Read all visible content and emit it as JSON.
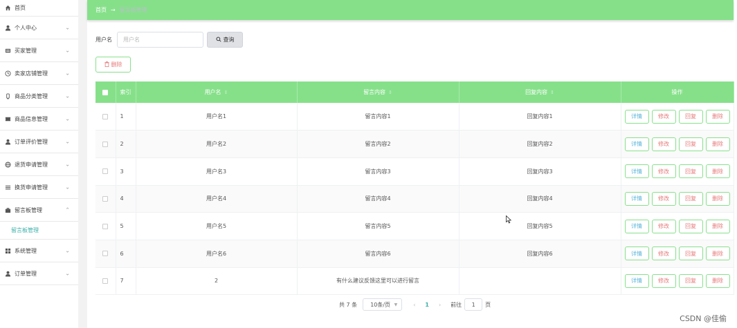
{
  "sidebar": {
    "items": [
      {
        "label": "首页",
        "icon": "home-icon",
        "chevron": false
      },
      {
        "label": "个人中心",
        "icon": "user-icon",
        "chevron": true
      },
      {
        "label": "买家管理",
        "icon": "list-icon",
        "chevron": true
      },
      {
        "label": "卖家店铺管理",
        "icon": "clock-icon",
        "chevron": true
      },
      {
        "label": "商品分类管理",
        "icon": "tag-icon",
        "chevron": true
      },
      {
        "label": "商品信息管理",
        "icon": "ticket-icon",
        "chevron": true
      },
      {
        "label": "订单评价管理",
        "icon": "user-icon",
        "chevron": true
      },
      {
        "label": "退货申请管理",
        "icon": "globe-icon",
        "chevron": true
      },
      {
        "label": "换货申请管理",
        "icon": "menu-icon",
        "chevron": true
      },
      {
        "label": "留言板管理",
        "icon": "briefcase-icon",
        "chevron": true,
        "expanded": true
      },
      {
        "label": "系统管理",
        "icon": "grid-icon",
        "chevron": true
      },
      {
        "label": "订单管理",
        "icon": "user-icon",
        "chevron": true
      }
    ],
    "submenu_label": "留言板管理"
  },
  "breadcrumb": {
    "home": "首页",
    "separator": "→",
    "current": "留言板管理"
  },
  "search": {
    "label": "用户名",
    "placeholder": "用户名",
    "button": "查询"
  },
  "toolbar": {
    "delete_label": "删除"
  },
  "table": {
    "headers": {
      "index": "索引",
      "username": "用户名",
      "content": "留言内容",
      "reply": "回复内容",
      "actions": "操作"
    },
    "rows": [
      {
        "index": "1",
        "username": "用户名1",
        "content": "留言内容1",
        "reply": "回复内容1"
      },
      {
        "index": "2",
        "username": "用户名2",
        "content": "留言内容2",
        "reply": "回复内容2"
      },
      {
        "index": "3",
        "username": "用户名3",
        "content": "留言内容3",
        "reply": "回复内容3"
      },
      {
        "index": "4",
        "username": "用户名4",
        "content": "留言内容4",
        "reply": "回复内容4"
      },
      {
        "index": "5",
        "username": "用户名5",
        "content": "留言内容5",
        "reply": "回复内容5"
      },
      {
        "index": "6",
        "username": "用户名6",
        "content": "留言内容6",
        "reply": "回复内容6"
      },
      {
        "index": "7",
        "username": "2",
        "content": "有什么建议反馈这里可以进行留言",
        "reply": ""
      }
    ],
    "action_labels": {
      "detail": "详情",
      "edit": "修改",
      "reply": "回复",
      "delete": "删除"
    }
  },
  "pagination": {
    "total": "共 7 条",
    "page_size": "10条/页",
    "prev": "‹",
    "current_page": "1",
    "next": "›",
    "goto_label": "前往",
    "goto_value": "1",
    "page_unit": "页"
  },
  "watermark": "CSDN @佳偷",
  "colors": {
    "accent": "#86e08a",
    "link": "#3cb0a8",
    "danger": "#e77b7b",
    "info": "#5ab4d8"
  }
}
